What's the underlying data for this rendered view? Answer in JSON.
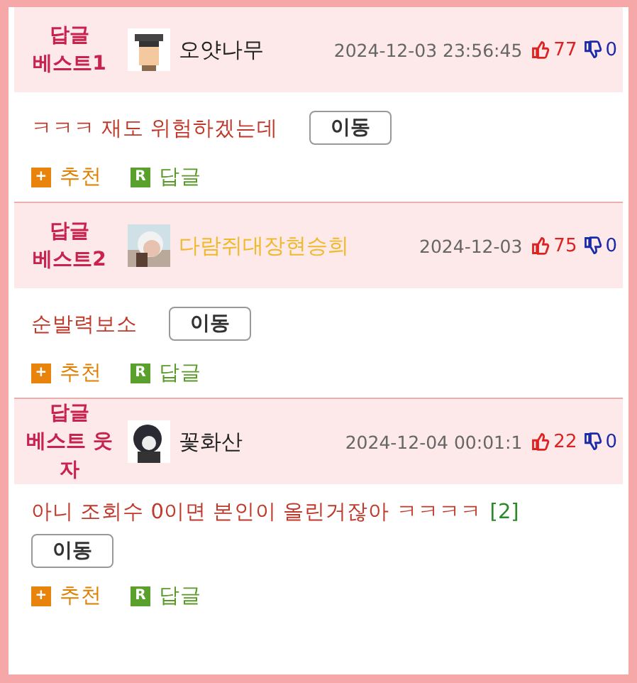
{
  "comments": [
    {
      "badge": [
        "답글",
        "베스트1"
      ],
      "author": {
        "name": "오얏나무",
        "color": "#222222"
      },
      "avatar": {
        "kind": "picture"
      },
      "time": "2024-12-03 23:56:45",
      "up": "77",
      "down": "0",
      "text": "ㅋㅋㅋ 재도 위험하겠는데",
      "move": "이동",
      "recommend": "추천",
      "reply": "답글",
      "recommend_icon": "+",
      "reply_icon": "R"
    },
    {
      "badge": [
        "답글",
        "베스트2"
      ],
      "author": {
        "name": "다람쥐대장현승희",
        "color": "#f0b92a"
      },
      "avatar": {
        "kind": "picture"
      },
      "time": "2024-12-03",
      "up": "75",
      "down": "0",
      "text": "순발력보소",
      "move": "이동",
      "recommend": "추천",
      "reply": "답글",
      "recommend_icon": "+",
      "reply_icon": "R"
    },
    {
      "badge": [
        "답글",
        "베스트 웃자"
      ],
      "author": {
        "name": "꽃화산",
        "color": "#222222"
      },
      "avatar": {
        "kind": "picture"
      },
      "time": "2024-12-04 00:01:1",
      "up": "22",
      "down": "0",
      "text": "아니 조회수 0이면 본인이 올린거잖아 ㅋㅋㅋㅋ",
      "reply_count": "[2]",
      "move": "이동",
      "recommend": "추천",
      "reply": "답글",
      "recommend_icon": "+",
      "reply_icon": "R"
    }
  ]
}
